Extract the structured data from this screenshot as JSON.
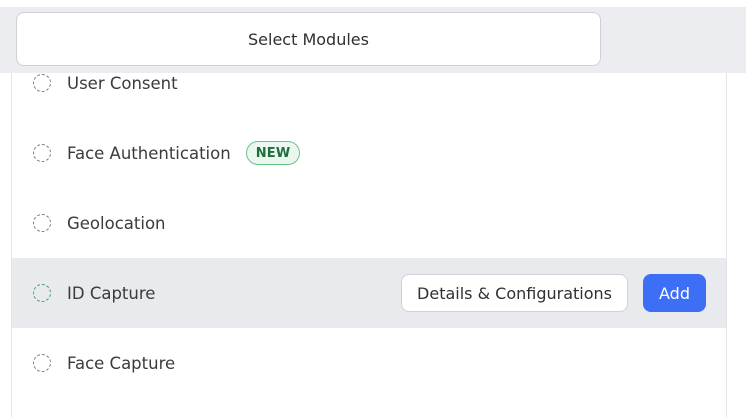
{
  "header": {
    "select_label": "Select Modules"
  },
  "modules": [
    {
      "label": "User Consent"
    },
    {
      "label": "Face Authentication",
      "badge": "NEW"
    },
    {
      "label": "Geolocation"
    },
    {
      "label": "ID Capture",
      "details_label": "Details & Configurations",
      "add_label": "Add"
    },
    {
      "label": "Face Capture"
    }
  ],
  "colors": {
    "accent": "#3d6ef6",
    "badge_border": "#6cc08a",
    "badge_bg": "#eaf7ef",
    "hover_row": "#e9eaed"
  }
}
